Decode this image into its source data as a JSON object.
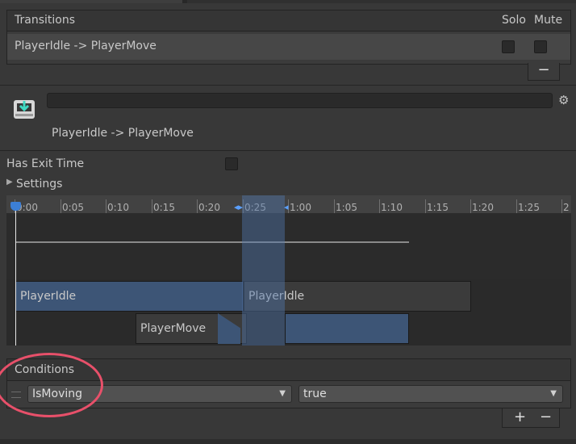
{
  "transitions": {
    "title": "Transitions",
    "solo_label": "Solo",
    "mute_label": "Mute",
    "items": [
      {
        "label": "PlayerIdle -> PlayerMove",
        "solo": false,
        "mute": false
      }
    ],
    "remove_label": "−"
  },
  "inspector": {
    "name_value": "",
    "subtitle": "PlayerIdle -> PlayerMove",
    "has_exit_time_label": "Has Exit Time",
    "has_exit_time": false,
    "settings_label": "Settings"
  },
  "timeline": {
    "ticks": [
      "0:00",
      "0:05",
      "0:10",
      "0:15",
      "0:20",
      "0:25",
      "1:00",
      "1:05",
      "1:10",
      "1:15",
      "1:20",
      "1:25",
      "2"
    ],
    "clips": {
      "source_first": "PlayerIdle",
      "source_second": "PlayerIdle",
      "destination": "PlayerMove"
    },
    "colors": {
      "clip_blue": "#3d5576",
      "highlight": "#5076aa",
      "cursor": "#3c7fd6"
    }
  },
  "conditions": {
    "title": "Conditions",
    "items": [
      {
        "parameter": "IsMoving",
        "value": "true"
      }
    ],
    "add_label": "+",
    "remove_label": "−"
  },
  "annotation": {
    "color": "#e8506a"
  }
}
